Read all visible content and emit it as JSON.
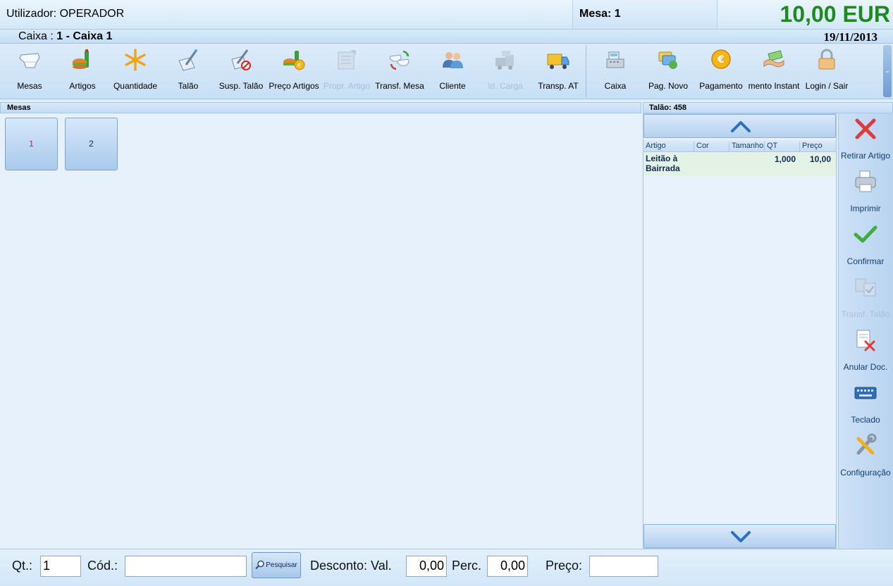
{
  "header": {
    "user": "Utilizador: OPERADOR",
    "mesa": "Mesa: 1",
    "total": "10,00 EUR"
  },
  "subheader": {
    "caixa_prefix": "Caixa : ",
    "caixa_value": "1 - Caixa 1",
    "date": "19/11/2013"
  },
  "toolbar": {
    "items": [
      {
        "label": "Mesas",
        "icon": "table-icon",
        "enabled": true
      },
      {
        "label": "Artigos",
        "icon": "food-drink-icon",
        "enabled": true
      },
      {
        "label": "Quantidade",
        "icon": "asterisk-icon",
        "enabled": true
      },
      {
        "label": "Talão",
        "icon": "pen-receipt-icon",
        "enabled": true
      },
      {
        "label": "Susp. Talão",
        "icon": "suspend-receipt-icon",
        "enabled": true
      },
      {
        "label": "Preço Artigos",
        "icon": "price-food-icon",
        "enabled": true
      },
      {
        "label": "Propr. Artigo",
        "icon": "article-properties-icon",
        "enabled": false
      },
      {
        "label": "Transf. Mesa",
        "icon": "transfer-table-icon",
        "enabled": true
      },
      {
        "label": "Cliente",
        "icon": "client-icon",
        "enabled": true
      },
      {
        "label": "Id. Carga",
        "icon": "cargo-id-icon",
        "enabled": false
      },
      {
        "label": "Transp. AT",
        "icon": "truck-icon",
        "enabled": true
      }
    ],
    "items_right": [
      {
        "label": "Caixa",
        "icon": "cash-register-icon",
        "enabled": true
      },
      {
        "label": "Pag. Novo",
        "icon": "new-payment-icon",
        "enabled": true
      },
      {
        "label": "Pagamento",
        "icon": "euro-coin-icon",
        "enabled": true
      },
      {
        "label": "mento Instant",
        "icon": "handshake-money-icon",
        "enabled": true
      },
      {
        "label": "Login / Sair",
        "icon": "padlock-icon",
        "enabled": true
      }
    ]
  },
  "mesas_panel": {
    "title": "Mesas",
    "tiles": [
      "1",
      "2"
    ]
  },
  "talao_panel": {
    "title": "Talão: 458",
    "columns": [
      "Artigo",
      "Cor",
      "Tamanho",
      "QT",
      "Preço"
    ],
    "rows": [
      {
        "artigo_line1": "Leitão à",
        "artigo_line2": "Bairrada",
        "cor": "",
        "tamanho": "",
        "qt": "1,000",
        "preco": "10,00"
      }
    ]
  },
  "side_actions": [
    {
      "label": "Retirar Artigo",
      "icon": "red-x-icon",
      "enabled": true
    },
    {
      "label": "Imprimir",
      "icon": "printer-icon",
      "enabled": true
    },
    {
      "label": "Confirmar",
      "icon": "green-check-icon",
      "enabled": true
    },
    {
      "label": "Transf. Talão",
      "icon": "transfer-receipt-icon",
      "enabled": false
    },
    {
      "label": "Anular Doc.",
      "icon": "cancel-document-icon",
      "enabled": true
    },
    {
      "label": "Teclado",
      "icon": "keyboard-icon",
      "enabled": true
    },
    {
      "label": "Configuração",
      "icon": "tools-icon",
      "enabled": true
    }
  ],
  "footer": {
    "qt_label": "Qt.:",
    "qt_value": "1",
    "cod_label": "Cód.:",
    "cod_value": "",
    "search_label": "Pesquisar",
    "desconto_label": "Desconto: Val.",
    "desconto_val": "0,00",
    "perc_label": "Perc.",
    "perc_value": "0,00",
    "preco_label": "Preço:",
    "preco_value": ""
  },
  "colors": {
    "total_green": "#1e8a1e",
    "tile_1_text": "#e000c0",
    "accent_blue": "#3a7bd5"
  }
}
